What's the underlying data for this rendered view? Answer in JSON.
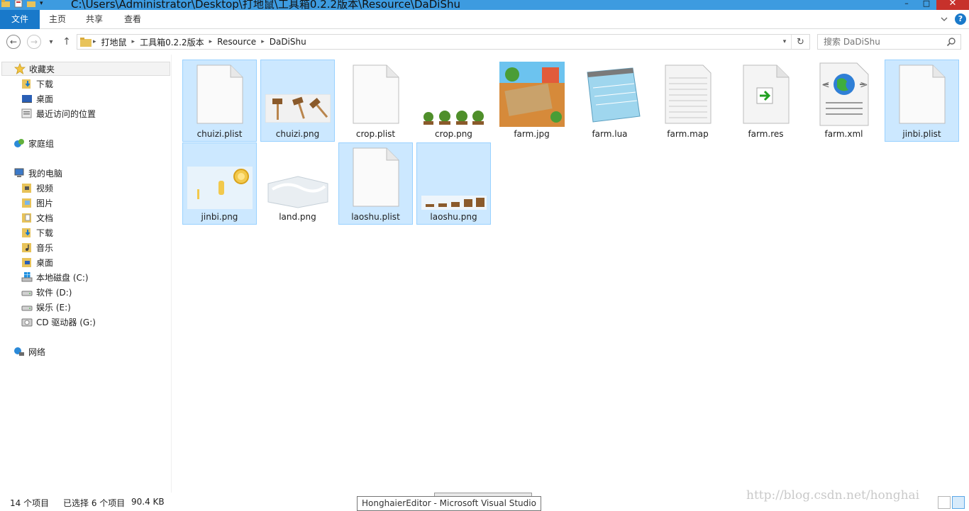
{
  "window": {
    "title": "C:\\Users\\Administrator\\Desktop\\打地鼠\\工具箱0.2.2版本\\Resource\\DaDiShu",
    "minimize_glyph": "–",
    "maximize_glyph": "□",
    "close_glyph": "✕"
  },
  "ribbon": {
    "tabs": [
      "文件",
      "主页",
      "共享",
      "查看"
    ],
    "help_label": "?"
  },
  "nav": {
    "back_glyph": "←",
    "forward_glyph": "→",
    "recent_glyph": "▾",
    "up_glyph": "↑",
    "breadcrumb": [
      "打地鼠",
      "工具箱0.2.2版本",
      "Resource",
      "DaDiShu"
    ],
    "refresh_glyph": "↻",
    "dropdown_glyph": "▾",
    "search_placeholder": "搜索 DaDiShu"
  },
  "sidebar": {
    "favorites": {
      "label": "收藏夹",
      "items": [
        "下载",
        "桌面",
        "最近访问的位置"
      ]
    },
    "homegroup": "家庭组",
    "computer": {
      "label": "我的电脑",
      "items": [
        "视频",
        "图片",
        "文档",
        "下载",
        "音乐",
        "桌面",
        "本地磁盘 (C:)",
        "软件 (D:)",
        "娱乐 (E:)",
        "CD 驱动器 (G:)"
      ]
    },
    "network": "网络"
  },
  "files": [
    {
      "name": "chuizi.plist",
      "selected": true,
      "icon": "blank-file-icon"
    },
    {
      "name": "chuizi.png",
      "selected": true,
      "icon": "hammer-sprites-icon"
    },
    {
      "name": "crop.plist",
      "selected": false,
      "icon": "blank-file-icon"
    },
    {
      "name": "crop.png",
      "selected": false,
      "icon": "crop-sprites-icon"
    },
    {
      "name": "farm.jpg",
      "selected": false,
      "icon": "farm-image-icon"
    },
    {
      "name": "farm.lua",
      "selected": false,
      "icon": "notepad-icon"
    },
    {
      "name": "farm.map",
      "selected": false,
      "icon": "text-file-icon"
    },
    {
      "name": "farm.res",
      "selected": false,
      "icon": "shortcut-file-icon"
    },
    {
      "name": "farm.xml",
      "selected": false,
      "icon": "xml-globe-icon"
    },
    {
      "name": "jinbi.plist",
      "selected": true,
      "icon": "blank-file-icon"
    },
    {
      "name": "jinbi.png",
      "selected": true,
      "icon": "coin-sprites-icon"
    },
    {
      "name": "land.png",
      "selected": false,
      "icon": "land-tile-icon"
    },
    {
      "name": "laoshu.plist",
      "selected": true,
      "icon": "blank-file-icon"
    },
    {
      "name": "laoshu.png",
      "selected": true,
      "icon": "mole-sprites-icon"
    }
  ],
  "status": {
    "count": "14 个项目",
    "selected": "已选择 6 个项目",
    "size": "90.4 KB"
  },
  "tooltip": "HonghaierEditor - Microsoft Visual Studio",
  "watermark": "http://blog.csdn.net/honghai",
  "colors": {
    "accent": "#1979ca",
    "selection_fill": "#cce8ff",
    "selection_border": "#99d1ff"
  }
}
